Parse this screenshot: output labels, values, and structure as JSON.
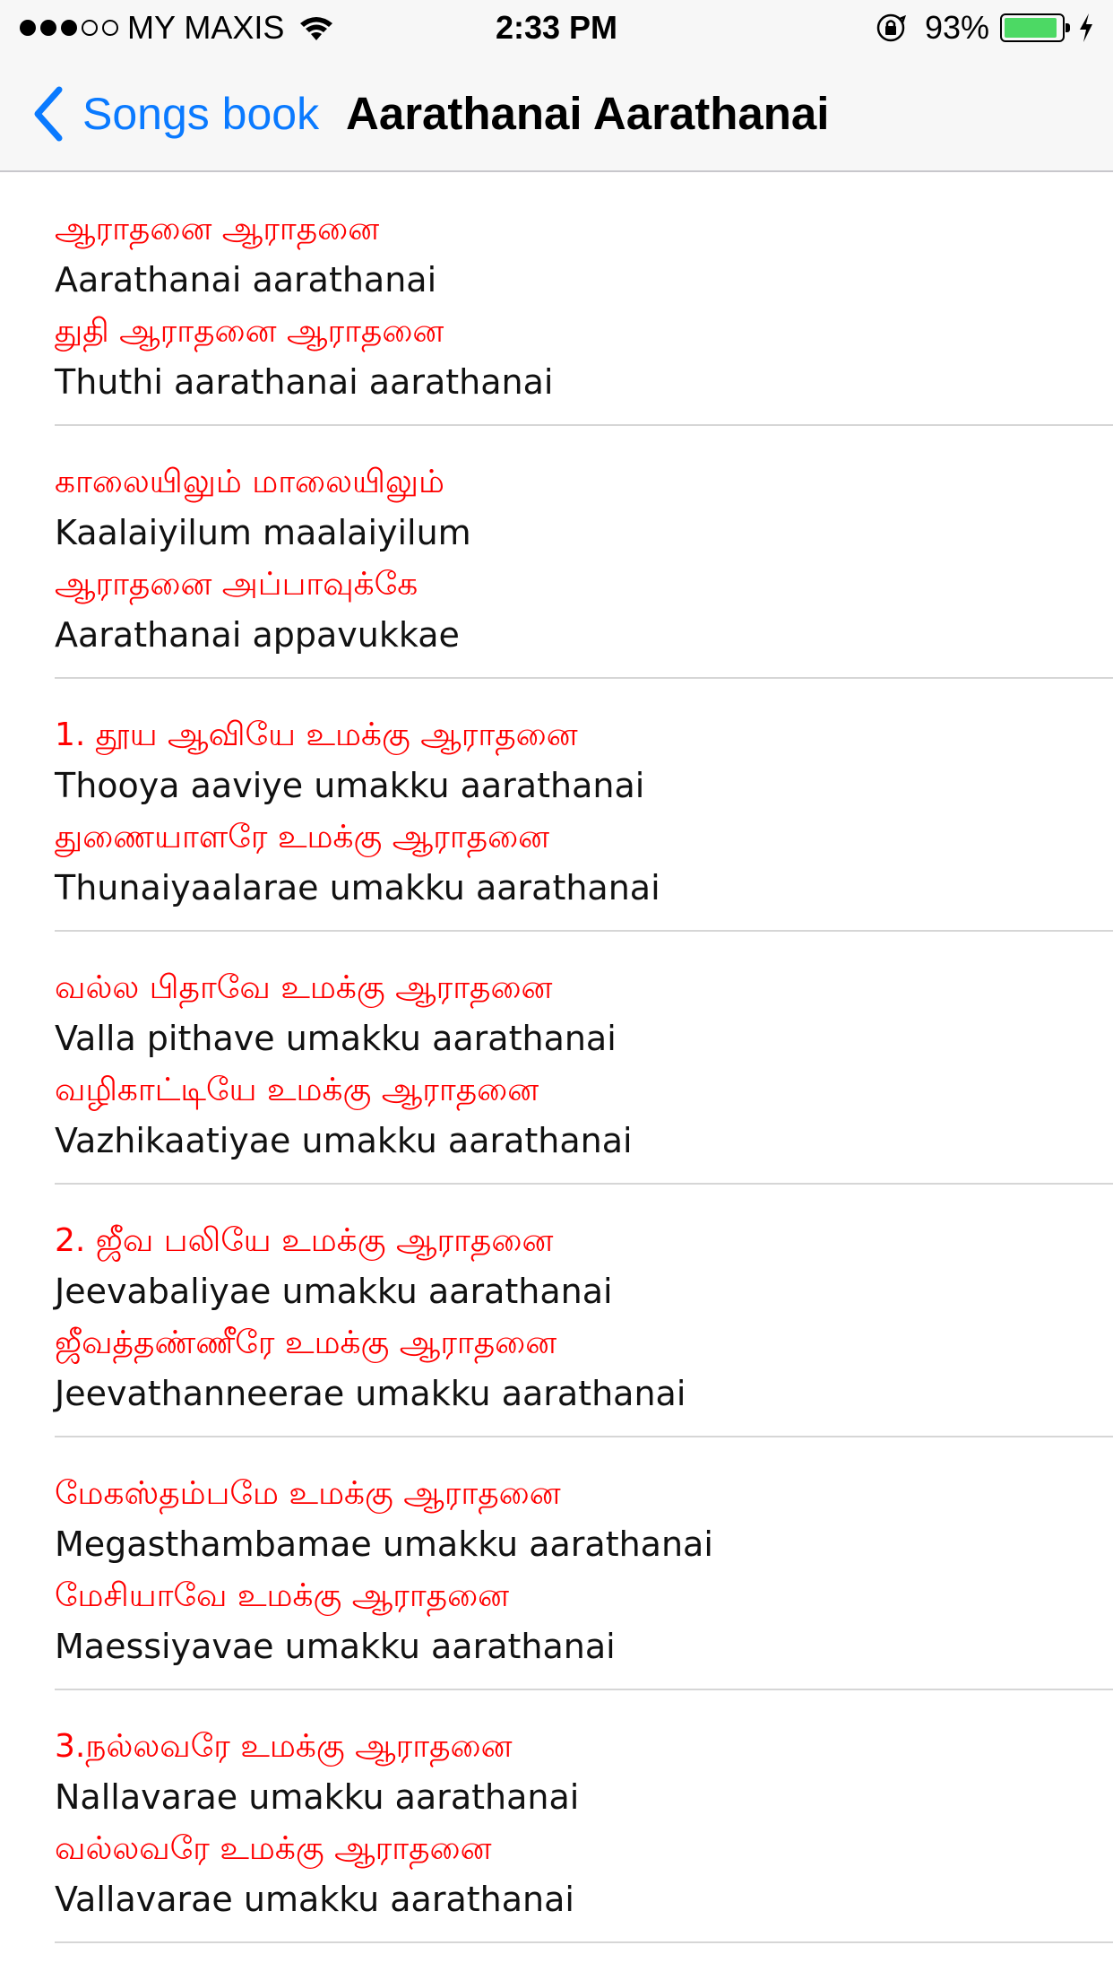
{
  "status_bar": {
    "carrier": "MY MAXIS",
    "time": "2:33 PM",
    "battery_percent": "93%",
    "battery_level": 0.93,
    "signal_bars_filled": 3,
    "signal_bars_total": 5,
    "icons": [
      "wifi-icon",
      "orientation-lock-icon",
      "battery-icon",
      "charging-bolt-icon"
    ],
    "battery_color": "#4cd964"
  },
  "nav": {
    "back_label": "Songs book",
    "title": "Aarathanai Aarathanai",
    "back_icon": "chevron-left-icon",
    "accent_color": "#0a7aff"
  },
  "lyrics": {
    "tamil_color": "#ff0000",
    "stanzas": [
      {
        "lines": [
          "ஆராதனை ஆராதனை",
          "Aarathanai aarathanai",
          "துதி ஆராதனை ஆராதனை",
          "Thuthi aarathanai aarathanai"
        ]
      },
      {
        "lines": [
          "காலையிலும் மாலையிலும்",
          "Kaalaiyilum maalaiyilum",
          "ஆராதனை அப்பாவுக்கே",
          "Aarathanai appavukkae"
        ]
      },
      {
        "lines": [
          "1. தூய ஆவியே உமக்கு ஆராதனை",
          "Thooya aaviye umakku aarathanai",
          "துணையாளரே உமக்கு ஆராதனை",
          "Thunaiyaalarae umakku aarathanai"
        ]
      },
      {
        "lines": [
          "வல்ல பிதாவே உமக்கு ஆராதனை",
          "Valla pithave umakku aarathanai",
          "வழிகாட்டியே உமக்கு ஆராதனை",
          "Vazhikaatiyae umakku aarathanai"
        ]
      },
      {
        "lines": [
          "2. ஜீவ பலியே உமக்கு ஆராதனை",
          "Jeevabaliyae umakku aarathanai",
          "ஜீவத்தண்ணீரே உமக்கு ஆராதனை",
          "Jeevathanneerae umakku aarathanai"
        ]
      },
      {
        "lines": [
          "மேகஸ்தம்பமே உமக்கு ஆராதனை",
          "Megasthambamae umakku aarathanai",
          "மேசியாவே உமக்கு ஆராதனை",
          "Maessiyavae umakku aarathanai"
        ]
      },
      {
        "lines": [
          "3.நல்லவரே உமக்கு ஆராதனை",
          "Nallavarae umakku aarathanai",
          "வல்லவரே உமக்கு ஆராதனை",
          "Vallavarae umakku aarathanai"
        ]
      }
    ]
  }
}
